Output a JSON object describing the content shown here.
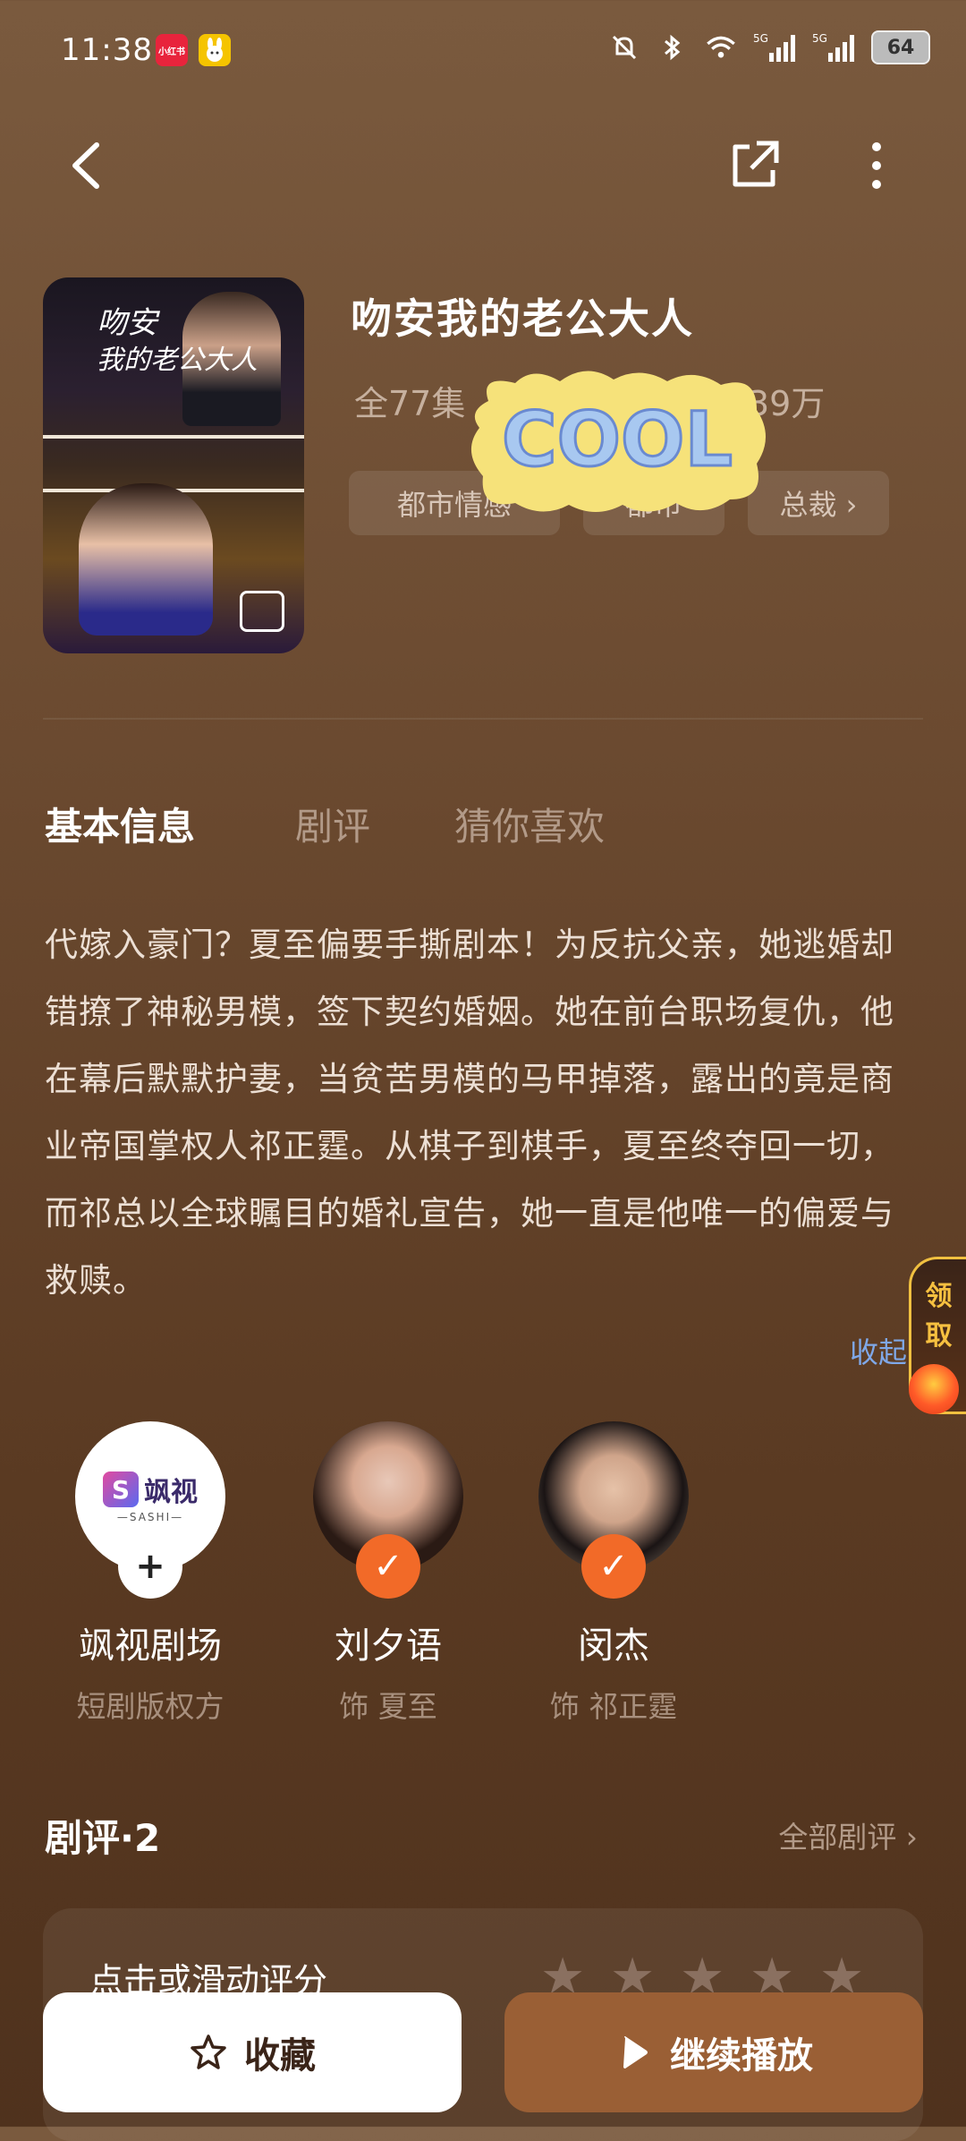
{
  "status_bar": {
    "time": "11:38",
    "app_badge_1": "小红书",
    "network_1": "5G",
    "network_2": "5G",
    "battery": "64"
  },
  "show": {
    "title": "吻安我的老公大人",
    "episodes": "全77集",
    "plays": "39万",
    "poster_title_line1": "吻安",
    "poster_title_line2": "我的老公大人",
    "tags": [
      "都市情感",
      "都市",
      "总裁 ›"
    ]
  },
  "tabs": [
    "基本信息",
    "剧评",
    "猜你喜欢"
  ],
  "synopsis": "代嫁入豪门？夏至偏要手撕剧本！为反抗父亲，她逃婚却错撩了神秘男模，签下契约婚姻。她在前台职场复仇，他在幕后默默护妻，当贫苦男模的马甲掉落，露出的竟是商业帝国掌权人祁正霆。从棋子到棋手，夏至终夺回一切，而祁总以全球瞩目的婚礼宣告，她一直是他唯一的偏爱与救赎。",
  "collapse_label": "收起",
  "float_tab": {
    "line1": "领",
    "line2": "取"
  },
  "people": [
    {
      "name": "飒视剧场",
      "role": "短剧版权方",
      "logo_text": "飒视",
      "logo_sub": "—SASHI—"
    },
    {
      "name": "刘夕语",
      "role": "饰 夏至"
    },
    {
      "name": "闵杰",
      "role": "饰 祁正霆"
    }
  ],
  "reviews": {
    "title": "剧评·2",
    "all_label": "全部剧评 ›",
    "rating_prompt": "点击或滑动评分",
    "stars": 5
  },
  "sticker_text": "COOL",
  "actions": {
    "favorite_label": "收藏",
    "play_label": "继续播放"
  },
  "colors": {
    "accent_orange": "#f26a28",
    "play_button": "#9a5f35",
    "link_blue": "#7fa8e8"
  }
}
